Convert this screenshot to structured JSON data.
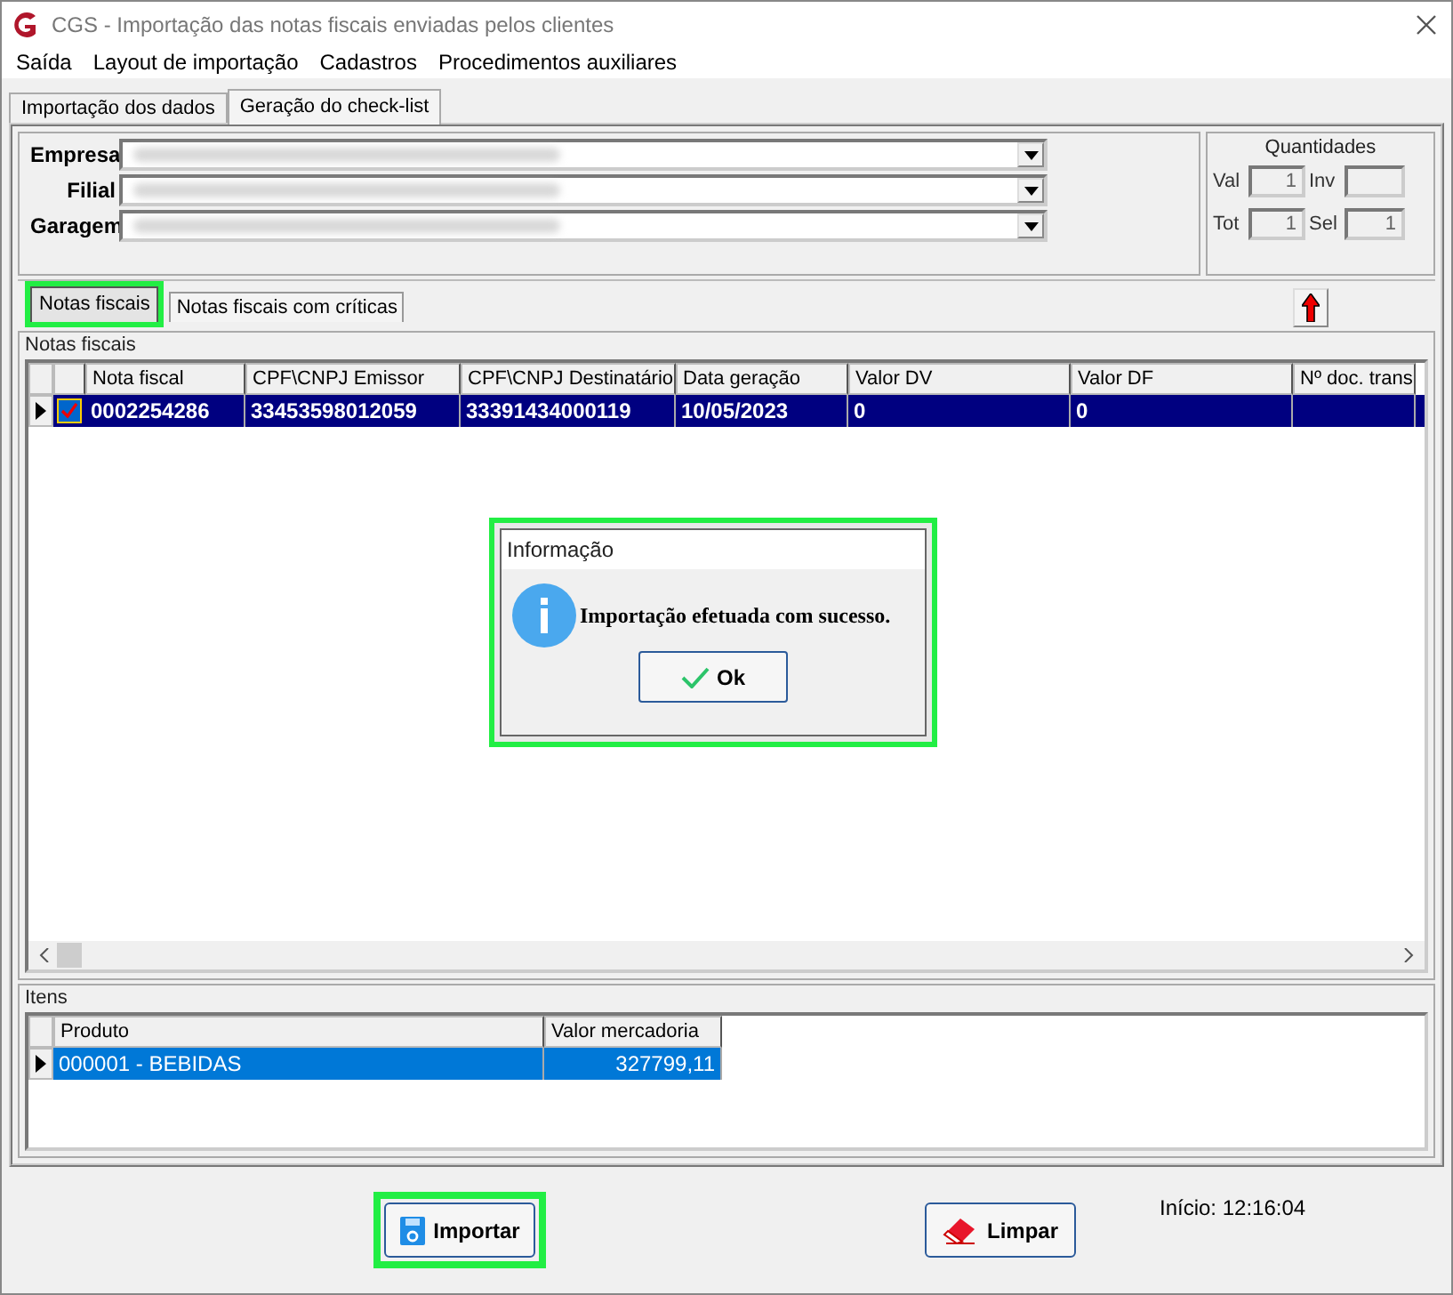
{
  "window": {
    "title": "CGS - Importação das notas fiscais enviadas pelos clientes"
  },
  "menu": [
    "Saída",
    "Layout de importação",
    "Cadastros",
    "Procedimentos auxiliares"
  ],
  "tabs": [
    {
      "label": "Importação dos dados",
      "selected": false
    },
    {
      "label": "Geração do check-list",
      "selected": true
    }
  ],
  "fields": [
    {
      "label": "Empresa"
    },
    {
      "label": "Filial"
    },
    {
      "label": "Garagem"
    }
  ],
  "quantities": {
    "title": "Quantidades",
    "items": [
      {
        "label": "Val",
        "value": "1"
      },
      {
        "label": "Inv",
        "value": ""
      },
      {
        "label": "Tot",
        "value": "1"
      },
      {
        "label": "Sel",
        "value": "1"
      }
    ]
  },
  "inner_tabs": [
    {
      "label": "Notas fiscais",
      "selected": true,
      "highlighted": true
    },
    {
      "label": "Notas fiscais com críticas",
      "selected": false,
      "highlighted": false
    }
  ],
  "notes_grid": {
    "title": "Notas fiscais",
    "columns": [
      "Nota fiscal",
      "CPF\\CNPJ Emissor",
      "CPF\\CNPJ Destinatário",
      "Data geração",
      "Valor DV",
      "Valor DF",
      "Nº doc. trans"
    ],
    "rows": [
      {
        "selected": true,
        "checked": true,
        "cells": [
          "0002254286",
          "33453598012059",
          "33391434000119",
          "10/05/2023",
          "0",
          "0",
          ""
        ]
      }
    ]
  },
  "dialog": {
    "title": "Informação",
    "message": "Importação efetuada com sucesso.",
    "button": "Ok",
    "highlighted": true
  },
  "items_grid": {
    "title": "Itens",
    "columns": [
      "Produto",
      "Valor mercadoria"
    ],
    "rows": [
      {
        "selected": true,
        "cells": [
          "000001 - BEBIDAS",
          "327799,11"
        ]
      }
    ]
  },
  "buttons": [
    {
      "kind": "import",
      "label": "Importar",
      "highlighted": true
    },
    {
      "kind": "clear",
      "label": "Limpar",
      "highlighted": false
    }
  ],
  "start_time": "Início: 12:16:04"
}
